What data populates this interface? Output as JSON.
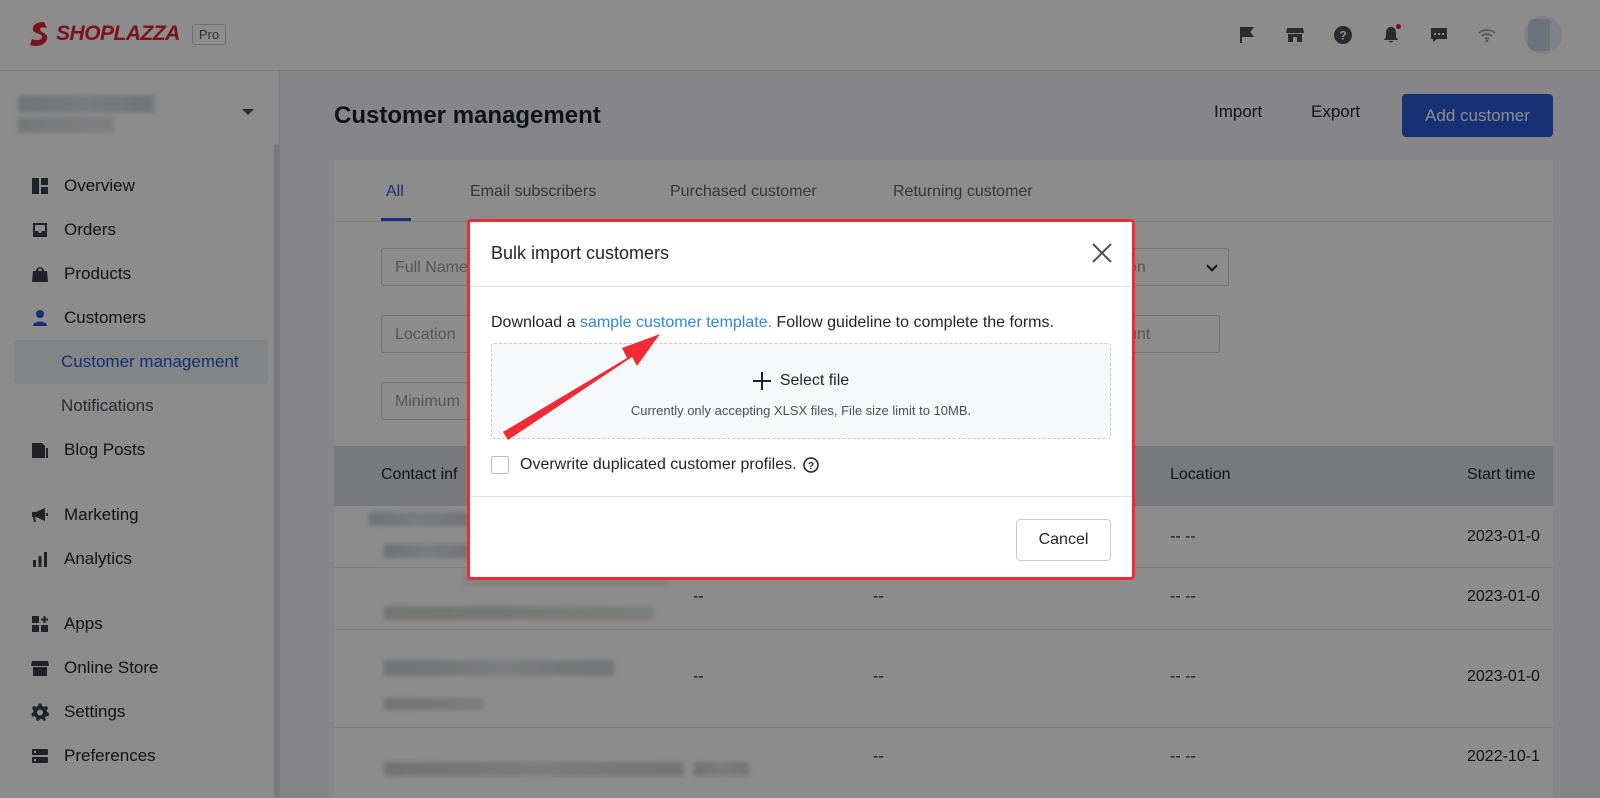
{
  "brand": {
    "name": "SHOPLAZZA",
    "badge": "Pro",
    "color": "#e0262c"
  },
  "topbar": {
    "icons": [
      "flag-icon",
      "store-icon",
      "help-icon",
      "bell-icon",
      "chat-icon",
      "wifi-icon",
      "avatar"
    ]
  },
  "sidebar": {
    "items": [
      {
        "label": "Overview",
        "icon": "overview-icon"
      },
      {
        "label": "Orders",
        "icon": "orders-icon"
      },
      {
        "label": "Products",
        "icon": "products-icon"
      },
      {
        "label": "Customers",
        "icon": "customer-icon"
      },
      {
        "label": "Customer management",
        "sub": true,
        "active": true
      },
      {
        "label": "Notifications",
        "sub": true
      },
      {
        "label": "Blog Posts",
        "icon": "blog-icon"
      },
      {
        "label": "Marketing",
        "icon": "megaphone-icon"
      },
      {
        "label": "Analytics",
        "icon": "analytics-icon"
      },
      {
        "label": "Apps",
        "icon": "apps-icon"
      },
      {
        "label": "Online Store",
        "icon": "store-icon"
      },
      {
        "label": "Settings",
        "icon": "gear-icon"
      },
      {
        "label": "Preferences",
        "icon": "preferences-icon"
      }
    ]
  },
  "header": {
    "title": "Customer management",
    "import_label": "Import",
    "export_label": "Export",
    "add_label": "Add customer",
    "accent": "#2b5ad6"
  },
  "tabs": [
    {
      "label": "All",
      "active": true
    },
    {
      "label": "Email subscribers"
    },
    {
      "label": "Purchased customer"
    },
    {
      "label": "Returning customer"
    }
  ],
  "filters": {
    "full_name": "Full Name",
    "location": "Location",
    "minimum": "Minimum",
    "right_select": "on",
    "right_input": "unt"
  },
  "table": {
    "headers": [
      "Contact inf",
      "Location",
      "Start time"
    ],
    "rows": [
      {
        "col2": "",
        "col3": "",
        "location": "-- --",
        "start": "2023-01-0"
      },
      {
        "col2": "--",
        "col3": "--",
        "location": "-- --",
        "start": "2023-01-0"
      },
      {
        "col2": "--",
        "col3": "--",
        "location": "-- --",
        "start": "2023-01-0"
      },
      {
        "col2": "",
        "col3": "--",
        "location": "-- --",
        "start": "2022-10-1"
      }
    ]
  },
  "modal": {
    "title": "Bulk import customers",
    "text_before": "Download a ",
    "link_text": "sample customer template.",
    "text_after": " Follow guideline to complete the forms.",
    "select_file": "Select file",
    "limit_text": "Currently only accepting XLSX files, File size limit to 10MB.",
    "overwrite_label": "Overwrite duplicated customer profiles.",
    "cancel_label": "Cancel",
    "highlight_color": "#ef2b36",
    "link_color": "#2e86de"
  }
}
